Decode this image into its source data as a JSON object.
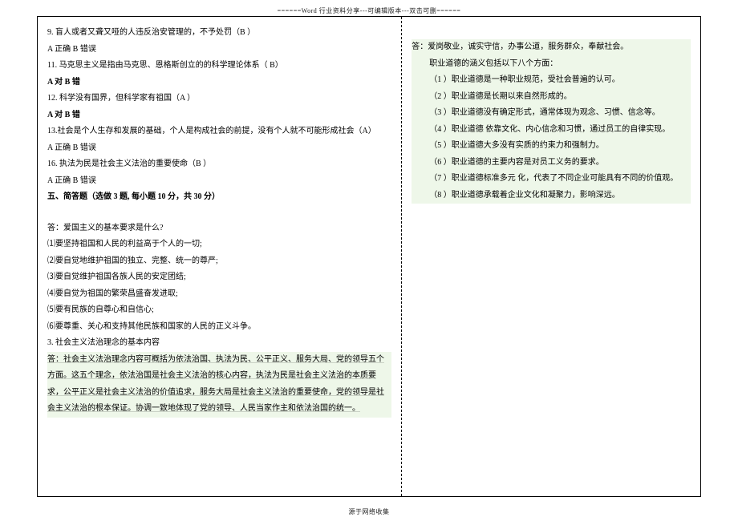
{
  "header": "======Word 行业资料分享---可编辑版本---双击可删======",
  "footer": "源于网络收集",
  "left": {
    "q9": "9. 盲人或者又聋又哑的人违反治安管理的，不予处罚（B ）",
    "q9_opts": "A 正确 B 错误",
    "q11": "11. 马克思主义是指由马克思、恩格斯创立的的科学理论体系（ B）",
    "q11_opts": "A 对   B 错",
    "q12": "12. 科学没有国界，但科学家有祖国（A ）",
    "q12_opts": "A 对   B 错",
    "q13": "13.社会是个人生存和发展的基础，个人是构成社会的前提，没有个人就不可能形成社会（A）",
    "q13_opts": "A  正确 B  错误",
    "q16": "16.  执法为民是社会主义法治的重要使命（B ）",
    "q16_opts": "A  正确 B  错误",
    "section5": "五、简答题（选做 3 题, 每小题 10 分，共 30 分）",
    "qA": "答：爱国主义的基本要求是什么?",
    "a1": "⑴要坚持祖国和人民的利益高于个人的一切;",
    "a2": "⑵要自觉地维护祖国的独立、完整、统一的尊严;",
    "a3": "⑶要自觉维护祖国各族人民的安定团结;",
    "a4": "⑷要自觉为祖国的繁荣昌盛奋发进取;",
    "a5": "⑸要有民族的自尊心和自信心;",
    "a6": "⑹要尊重、关心和支持其他民族和国家的人民的正义斗争。",
    "q3": "3. 社会主义法治理念的基本内容",
    "q3_ans": "答：社会主义法治理念内容可概括为依法治国、执法为民、公平正义、服务大局、党的领导五个方面。这五个理念，依法治国是社会主义法治的核心内容，执法为民是社会主义法治的本质要求，公平正义是社会主义法治的价值追求，服务大局是社会主义法治的重要使命，党的领导是社会主义法治的根本保证。协调一致地体现了党的领导、人民当家作主和依法治国的统一。"
  },
  "right": {
    "ans_head": "答：爱岗敬业，诚实守信，办事公道，服务群众，奉献社会。",
    "intro": "职业道德的涵义包括以下八个方面：",
    "p1": "（1 ）职业道德是一种职业规范，受社会普遍的认可。",
    "p2": "（2 ）职业道德是长期以来自然形成的。",
    "p3": "（3 ）职业道德没有确定形式，通常体现为观念、习惯、信念等。",
    "p4": "（4 ）职业道德  依靠文化、内心信念和习惯，通过员工的自律实现。",
    "p5": "（5 ）职业道德大多没有实质的约束力和强制力。",
    "p6": "（6 ）职业道德的主要内容是对员工义务的要求。",
    "p7": "（7 ）职业道德标准多元  化，代表了不同企业可能具有不同的价值观。",
    "p8": "（8 ）职业道德承载着企业文化和凝聚力，影响深远。"
  }
}
